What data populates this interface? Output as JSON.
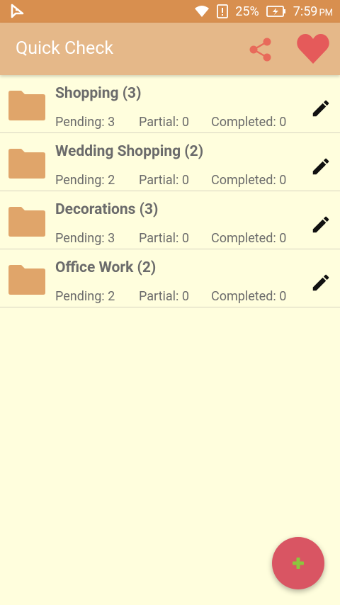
{
  "status_bar": {
    "battery_percent": "25%",
    "time": "7:59",
    "period": "PM",
    "icons": [
      "app-notification-icon",
      "wifi-icon",
      "sim-alert-icon",
      "battery-charging-icon"
    ]
  },
  "toolbar": {
    "title": "Quick Check",
    "icons": [
      "share-icon",
      "heart-icon"
    ]
  },
  "lists": [
    {
      "name": "Shopping (3)",
      "pending": "Pending: 3",
      "partial": "Partial: 0",
      "completed": "Completed: 0"
    },
    {
      "name": "Wedding Shopping (2)",
      "pending": "Pending: 2",
      "partial": "Partial: 0",
      "completed": "Completed: 0"
    },
    {
      "name": "Decorations (3)",
      "pending": "Pending: 3",
      "partial": "Partial: 0",
      "completed": "Completed: 0"
    },
    {
      "name": "Office Work (2)",
      "pending": "Pending: 2",
      "partial": "Partial: 0",
      "completed": "Completed: 0"
    }
  ],
  "fab": {
    "icon": "plus-icon"
  },
  "colors": {
    "status_bar": "#d88f4f",
    "toolbar": "#e5b889",
    "background": "#fffedd",
    "folder": "#e0a56a",
    "share_icon": "#e86a5a",
    "heart_icon": "#e55a5a",
    "fab": "#d95563",
    "fab_plus": "#8cc63e"
  }
}
